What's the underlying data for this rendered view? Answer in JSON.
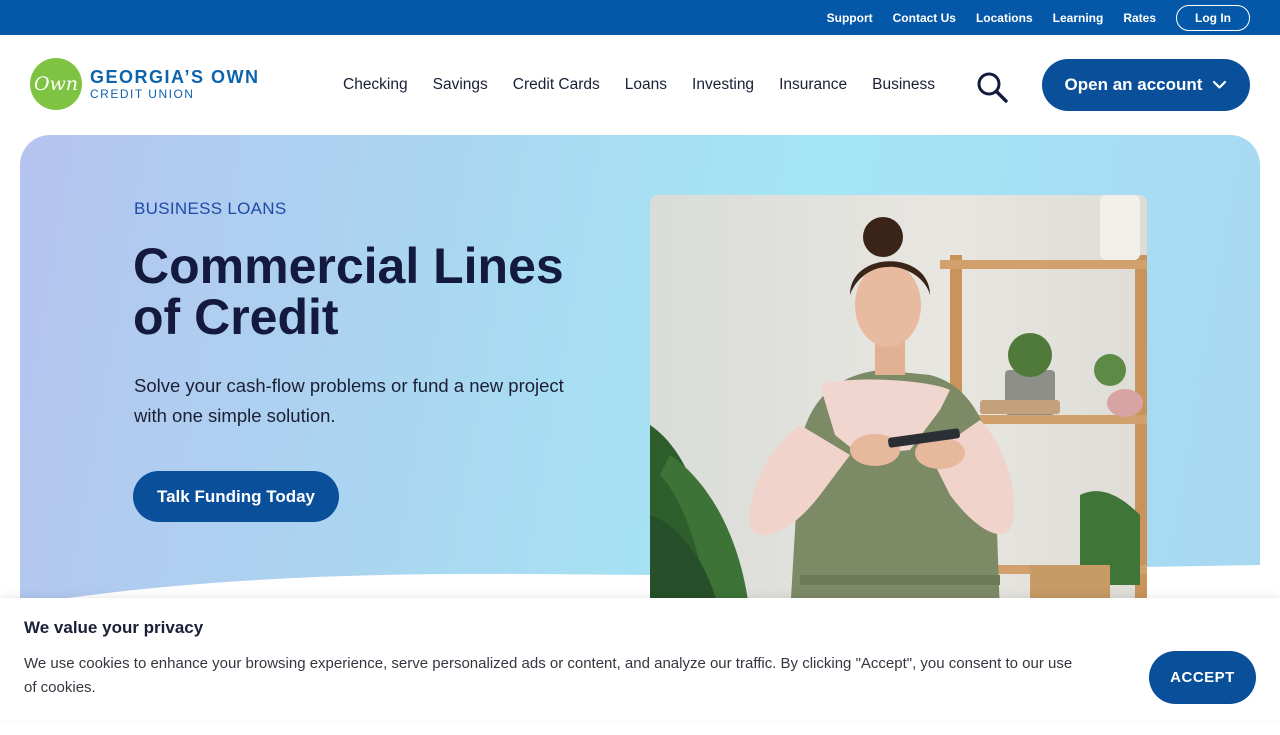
{
  "utility_nav": {
    "links": [
      "Support",
      "Contact Us",
      "Locations",
      "Learning",
      "Rates"
    ],
    "login_label": "Log In"
  },
  "brand": {
    "logo_mark": "Own",
    "name_line1": "GEORGIA’S OWN",
    "name_line2": "CREDIT UNION"
  },
  "main_nav": {
    "items": [
      "Checking",
      "Savings",
      "Credit Cards",
      "Loans",
      "Investing",
      "Insurance",
      "Business"
    ],
    "search_icon": "search-icon",
    "open_account_label": "Open an account"
  },
  "hero": {
    "eyebrow": "BUSINESS LOANS",
    "headline": "Commercial Lines of Credit",
    "subhead": "Solve your cash-flow problems or fund a new project with one simple solution.",
    "cta_label": "Talk Funding Today"
  },
  "cookie_banner": {
    "title": "We value your privacy",
    "body": "We use cookies to enhance your browsing experience, serve personalized ads or content, and analyze our traffic. By clicking \"Accept\", you consent to our use of cookies.",
    "accept_label": "ACCEPT"
  },
  "colors": {
    "utility_bar": "#0558a7",
    "primary_button": "#0a4f9a",
    "logo_green": "#7fc342",
    "brand_blue": "#0e63ad",
    "headline": "#131a3d"
  }
}
